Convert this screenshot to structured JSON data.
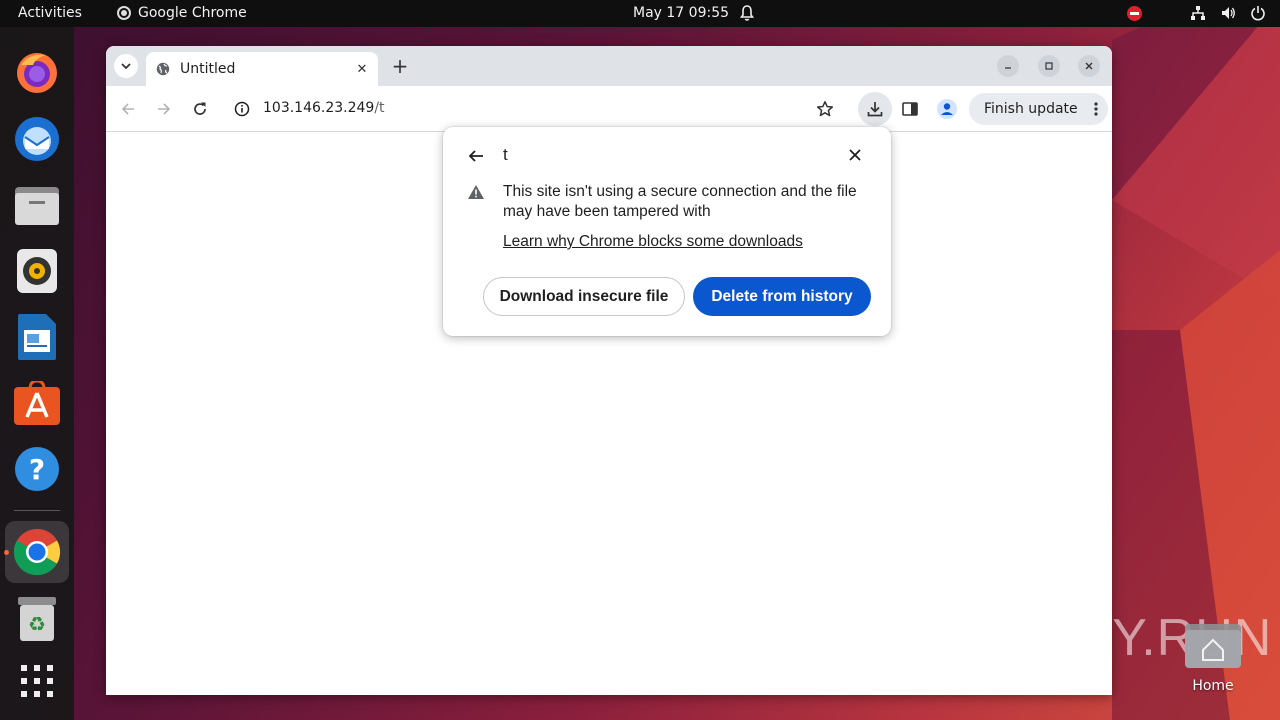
{
  "topbar": {
    "activities": "Activities",
    "app_name": "Google Chrome",
    "clock": "May 17  09:55"
  },
  "dock": {
    "items": [
      {
        "name": "firefox-icon"
      },
      {
        "name": "thunderbird-icon"
      },
      {
        "name": "files-icon"
      },
      {
        "name": "rhythmbox-icon"
      },
      {
        "name": "libreoffice-writer-icon"
      },
      {
        "name": "app-center-icon"
      },
      {
        "name": "help-icon"
      },
      {
        "name": "chrome-icon",
        "active": true
      },
      {
        "name": "trash-icon"
      },
      {
        "name": "app-grid-icon"
      }
    ]
  },
  "browser": {
    "tab_title": "Untitled",
    "url_host": "103.146.23.249",
    "url_path": "/t",
    "finish_update": "Finish update"
  },
  "download_popup": {
    "filename": "t",
    "message": "This site isn't using a secure connection and the file may have been tampered with",
    "learn_link": "Learn why Chrome blocks some downloads",
    "download_insecure": "Download insecure file",
    "delete_from_history": "Delete from history"
  },
  "desktop": {
    "home_label": "Home",
    "watermark": "ANY.RUN"
  },
  "colors": {
    "accent_blue": "#0b57d0",
    "ubuntu_orange": "#e95420",
    "topbar": "#0f0f0f"
  }
}
